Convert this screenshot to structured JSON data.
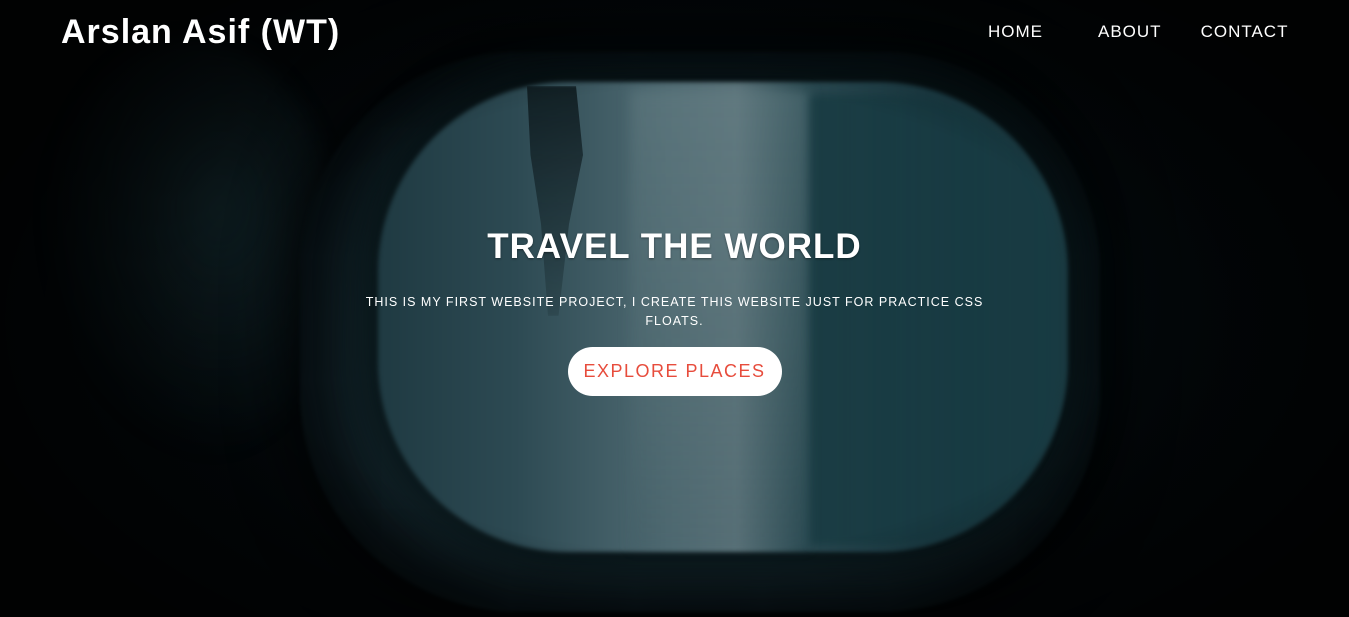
{
  "header": {
    "brand": "Arslan Asif (WT)",
    "nav": [
      {
        "label": "HOME"
      },
      {
        "label": "ABOUT"
      },
      {
        "label": "CONTACT"
      }
    ]
  },
  "hero": {
    "title": "TRAVEL THE WORLD",
    "description": "THIS IS MY FIRST WEBSITE PROJECT, I CREATE THIS WEBSITE JUST FOR PRACTICE CSS FLOATS.",
    "button_label": "EXPLORE PLACES"
  },
  "colors": {
    "background": "#020608",
    "text": "#ffffff",
    "button_bg": "#ffffff",
    "button_text": "#e74c3c"
  }
}
